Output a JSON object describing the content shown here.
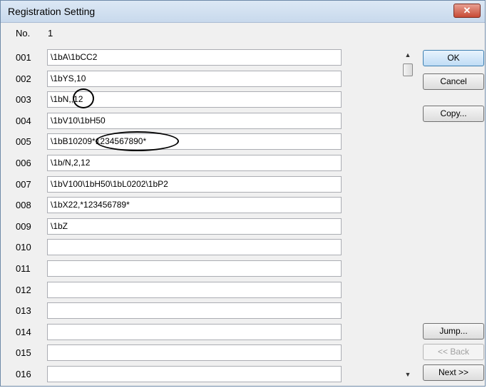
{
  "window": {
    "title": "Registration Setting",
    "close_glyph": "✕"
  },
  "record": {
    "no_label": "No.",
    "no_value": "1"
  },
  "rows": [
    {
      "label": "001",
      "value": "\\1bA\\1bCC2"
    },
    {
      "label": "002",
      "value": "\\1bYS,10"
    },
    {
      "label": "003",
      "value": "\\1bN,,12"
    },
    {
      "label": "004",
      "value": "\\1bV10\\1bH50"
    },
    {
      "label": "005",
      "value": "\\1bB10209*1234567890*"
    },
    {
      "label": "006",
      "value": "\\1b/N,2,12"
    },
    {
      "label": "007",
      "value": "\\1bV100\\1bH50\\1bL0202\\1bP2"
    },
    {
      "label": "008",
      "value": "\\1bX22,*123456789*"
    },
    {
      "label": "009",
      "value": "\\1bZ"
    },
    {
      "label": "010",
      "value": ""
    },
    {
      "label": "011",
      "value": ""
    },
    {
      "label": "012",
      "value": ""
    },
    {
      "label": "013",
      "value": ""
    },
    {
      "label": "014",
      "value": ""
    },
    {
      "label": "015",
      "value": ""
    },
    {
      "label": "016",
      "value": ""
    }
  ],
  "buttons": {
    "ok": "OK",
    "cancel": "Cancel",
    "copy": "Copy...",
    "jump": "Jump...",
    "back": "<< Back",
    "next": "Next >>"
  },
  "scrollbar": {
    "up_glyph": "▲",
    "down_glyph": "▼"
  }
}
